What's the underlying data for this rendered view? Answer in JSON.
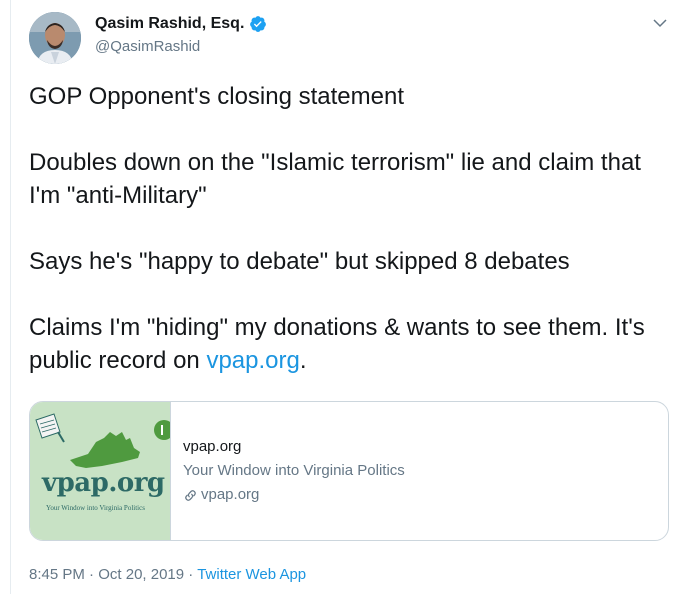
{
  "author": {
    "name": "Qasim Rashid, Esq.",
    "handle": "@QasimRashid",
    "verified": true
  },
  "icons": {
    "verified": "verified-badge-icon",
    "caret": "chevron-down-icon",
    "link": "link-icon"
  },
  "tweet": {
    "paragraphs": [
      "GOP Opponent's closing statement",
      "Doubles down on the \"Islamic terrorism\" lie and claim that I'm \"anti-Military\"",
      "Says he's \"happy to debate\" but skipped 8 debates"
    ],
    "last_paragraph_pre": "Claims I'm \"hiding\" my donations & wants to see them. It's public record on ",
    "last_paragraph_link": "vpap.org",
    "last_paragraph_post": "."
  },
  "card": {
    "domain_top": "vpap.org",
    "description": "Your Window into Virginia Politics",
    "domain_bottom": "vpap.org",
    "logo_text": "vpap.org",
    "logo_tagline": "Your Window into Virginia Politics"
  },
  "footer": {
    "time": "8:45 PM",
    "separator": "·",
    "date": "Oct 20, 2019",
    "app": "Twitter Web App"
  },
  "colors": {
    "link": "#1b95e0",
    "text": "#14171a",
    "muted": "#657786",
    "border": "#ccd6dd",
    "verified": "#1da1f2",
    "card_bg": "#c8e2c5",
    "logo": "#2d6a66"
  }
}
